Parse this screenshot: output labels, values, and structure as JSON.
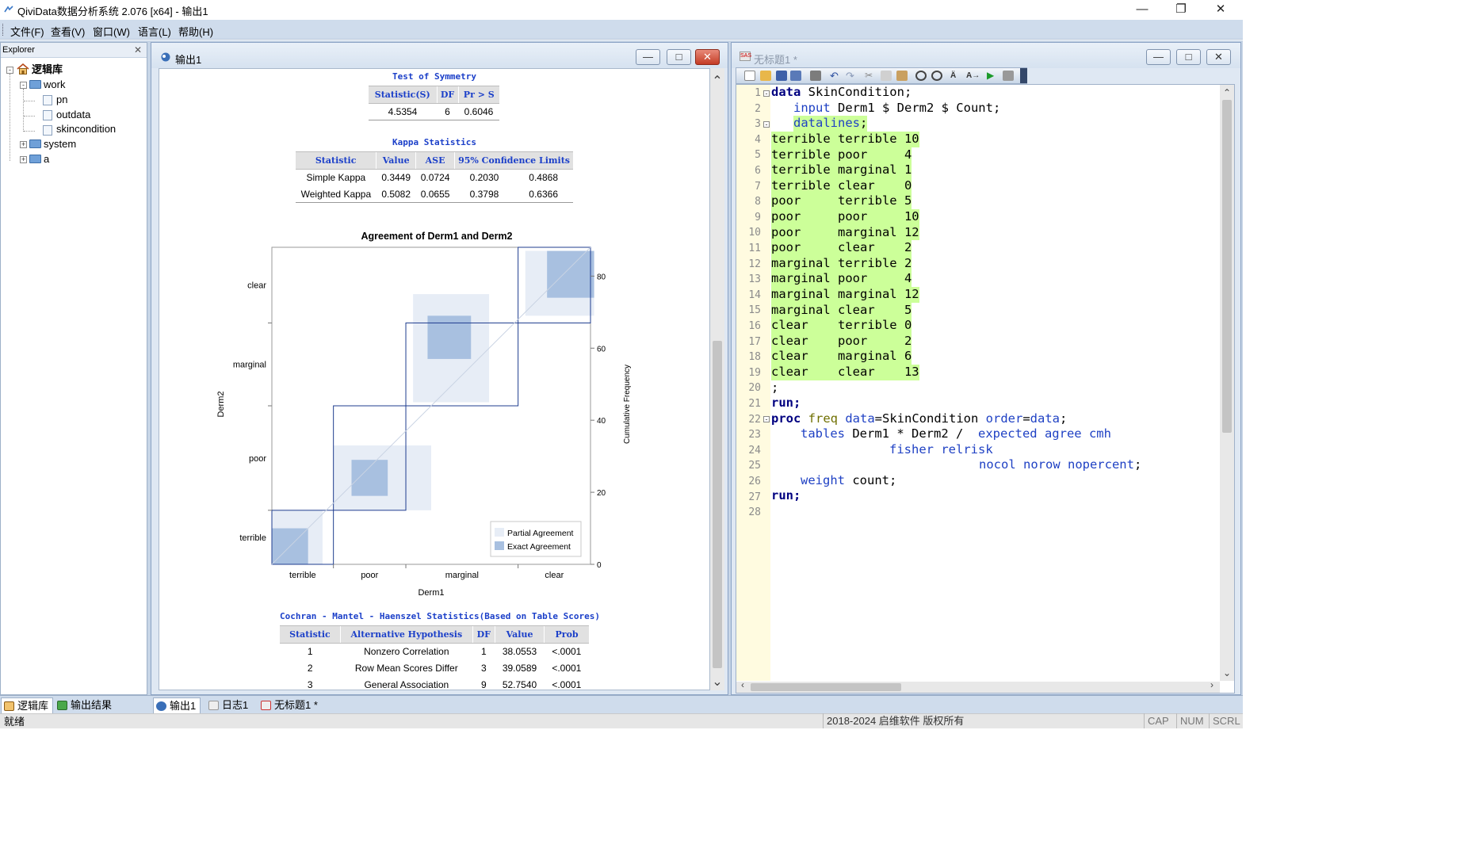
{
  "window": {
    "title": "QiviData数据分析系统 2.076 [x64] - 输出1"
  },
  "menu": [
    "文件(F)",
    "查看(V)",
    "窗口(W)",
    "语言(L)",
    "帮助(H)"
  ],
  "explorer": {
    "header": "Explorer",
    "root": "逻辑库",
    "items": [
      {
        "label": "work"
      },
      {
        "label": "pn"
      },
      {
        "label": "outdata"
      },
      {
        "label": "skincondition"
      },
      {
        "label": "system"
      },
      {
        "label": "a"
      }
    ]
  },
  "output_window": {
    "title": "输出1"
  },
  "symmetry": {
    "title": "Test of Symmetry",
    "headers": [
      "Statistic(S)",
      "DF",
      "Pr > S"
    ],
    "row": [
      "4.5354",
      "6",
      "0.6046"
    ]
  },
  "kappa": {
    "title": "Kappa Statistics",
    "headers": [
      "Statistic",
      "Value",
      "ASE",
      "95% Confidence Limits"
    ],
    "rows": [
      [
        "Simple Kappa",
        "0.3449",
        "0.0724",
        "0.2030",
        "0.4868"
      ],
      [
        "Weighted Kappa",
        "0.5082",
        "0.0655",
        "0.3798",
        "0.6366"
      ]
    ]
  },
  "chart_data": {
    "type": "agreement-plot",
    "title": "Agreement of Derm1 and Derm2",
    "xlabel": "Derm1",
    "ylabel": "Derm2",
    "y2label": "Cumulative Frequency",
    "categories": [
      "terrible",
      "poor",
      "marginal",
      "clear"
    ],
    "counts": [
      [
        10,
        4,
        1,
        0
      ],
      [
        5,
        10,
        12,
        2
      ],
      [
        2,
        4,
        12,
        5
      ],
      [
        0,
        2,
        6,
        13
      ]
    ],
    "total": 88,
    "y2ticks": [
      0,
      20,
      40,
      60,
      80
    ],
    "legend": {
      "position": "bottom-right",
      "entries": [
        "Partial Agreement",
        "Exact Agreement"
      ]
    },
    "colors": {
      "partial": "#e7edf6",
      "exact": "#a8c0e0",
      "frame": "#1f3d8f"
    }
  },
  "cmh": {
    "title": "Cochran - Mantel - Haenszel Statistics(Based on Table Scores)",
    "headers": [
      "Statistic",
      "Alternative Hypothesis",
      "DF",
      "Value",
      "Prob"
    ],
    "rows": [
      [
        "1",
        "Nonzero Correlation",
        "1",
        "38.0553",
        "<.0001"
      ],
      [
        "2",
        "Row Mean Scores Differ",
        "3",
        "39.0589",
        "<.0001"
      ],
      [
        "3",
        "General Association",
        "9",
        "52.7540",
        "<.0001"
      ]
    ]
  },
  "code_window": {
    "title": "无标题1 *"
  },
  "code": {
    "line_numbers": [
      "1",
      "2",
      "3",
      "4",
      "5",
      "6",
      "7",
      "8",
      "9",
      "10",
      "11",
      "12",
      "13",
      "14",
      "15",
      "16",
      "17",
      "18",
      "19",
      "20",
      "21",
      "22",
      "23",
      "24",
      "25",
      "26",
      "27",
      "28"
    ],
    "l1": {
      "kw": "data",
      "rest": " SkinCondition;"
    },
    "l2": {
      "kw": "input",
      "rest": " Derm1 $ Derm2 $ Count;"
    },
    "l3": {
      "kw": "datalines",
      "rest": ";"
    },
    "datalines": [
      "terrible terrible 10",
      "terrible poor     4",
      "terrible marginal 1",
      "terrible clear    0",
      "poor     terrible 5",
      "poor     poor     10",
      "poor     marginal 12",
      "poor     clear    2",
      "marginal terrible 2",
      "marginal poor     4",
      "marginal marginal 12",
      "marginal clear    5",
      "clear    terrible 0",
      "clear    poor     2",
      "clear    marginal 6",
      "clear    clear    13"
    ],
    "l20": ";",
    "l21": "run;",
    "l22": {
      "kw": "proc",
      "proc": "freq",
      "opt1": "data",
      "val1": "=SkinCondition ",
      "opt2": "order",
      "eq": "=",
      "val2": "data",
      "end": ";"
    },
    "l23": {
      "kw": "tables",
      "rest": " Derm1 * Derm2 /  ",
      "opts": "expected agree cmh"
    },
    "l24": "fisher relrisk",
    "l25": {
      "opts": "nocol norow nopercent",
      "end": ";"
    },
    "l26": {
      "kw": "weight",
      "rest": " count;"
    },
    "l27": "run;"
  },
  "bottom_tabs": {
    "left": [
      "逻辑库",
      "输出结果"
    ],
    "docs": [
      "输出1",
      "日志1",
      "无标题1 *"
    ]
  },
  "status": {
    "text": "就绪",
    "copyright": "2018-2024 启维软件 版权所有",
    "cap": "CAP",
    "num": "NUM",
    "scrl": "SCRL"
  }
}
